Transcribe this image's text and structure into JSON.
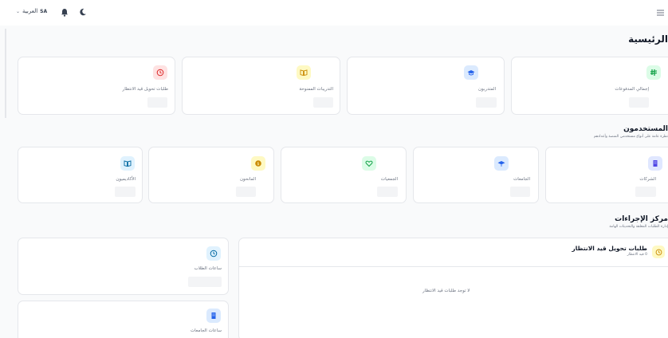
{
  "header": {
    "language_label": "العربية",
    "language_code": "SA",
    "icons": [
      "chevron-down-icon",
      "bell-icon",
      "moon-icon",
      "menu-icon"
    ]
  },
  "main": {
    "title": "الرئيسية",
    "stats": [
      {
        "label": "إجمالي المدفوعات",
        "icon": "riyal-icon",
        "color": "#16a34a",
        "bg": "#dcfce7"
      },
      {
        "label": "المتدربون",
        "icon": "graduation-cap-icon",
        "color": "#2563eb",
        "bg": "#dbeafe"
      },
      {
        "label": "التدريبات الممنوحة",
        "icon": "book-icon",
        "color": "#ca8a04",
        "bg": "#fef9c3"
      },
      {
        "label": "طلبات تحويل قيد الانتظار",
        "icon": "clock-icon",
        "color": "#dc2626",
        "bg": "#fee2e2"
      }
    ]
  },
  "users": {
    "title": "المستخدمون",
    "subtitle": "نظرة عامة على أنواع مستخدمي المنصة وأعدادهم",
    "cards": [
      {
        "label": "الشركات",
        "icon": "building-icon",
        "color": "#4f46e5",
        "bg": "#e0e7ff"
      },
      {
        "label": "الجامعات",
        "icon": "graduation-cap-icon",
        "color": "#2563eb",
        "bg": "#dbeafe"
      },
      {
        "label": "الجمعيات",
        "icon": "heart-icon",
        "color": "#16a34a",
        "bg": "#dcfce7"
      },
      {
        "label": "المانحون",
        "icon": "coin-icon",
        "color": "#ca8a04",
        "bg": "#fef9c3"
      },
      {
        "label": "الأكاديميون",
        "icon": "book-icon",
        "color": "#0369a1",
        "bg": "#e0f2fe"
      }
    ]
  },
  "actions": {
    "title": "مركز الإجراءات",
    "subtitle": "إدارة الطلبات المعلقة والتحديثات الهامة",
    "pending": {
      "title": "طلبات تحويل قيد الانتظار",
      "count_text": "0 قيد الانتظار",
      "empty_text": "لا توجد طلبات قيد الانتظار",
      "icon": "clock-icon",
      "color": "#ca8a04",
      "bg": "#fef9c3"
    },
    "side_cards": [
      {
        "label": "ساعات الطلاب",
        "icon": "clock-icon",
        "color": "#0369a1",
        "bg": "#e0f2fe"
      },
      {
        "label": "ساعات الجامعات",
        "icon": "building-icon",
        "color": "#2563eb",
        "bg": "#dbeafe"
      }
    ]
  }
}
